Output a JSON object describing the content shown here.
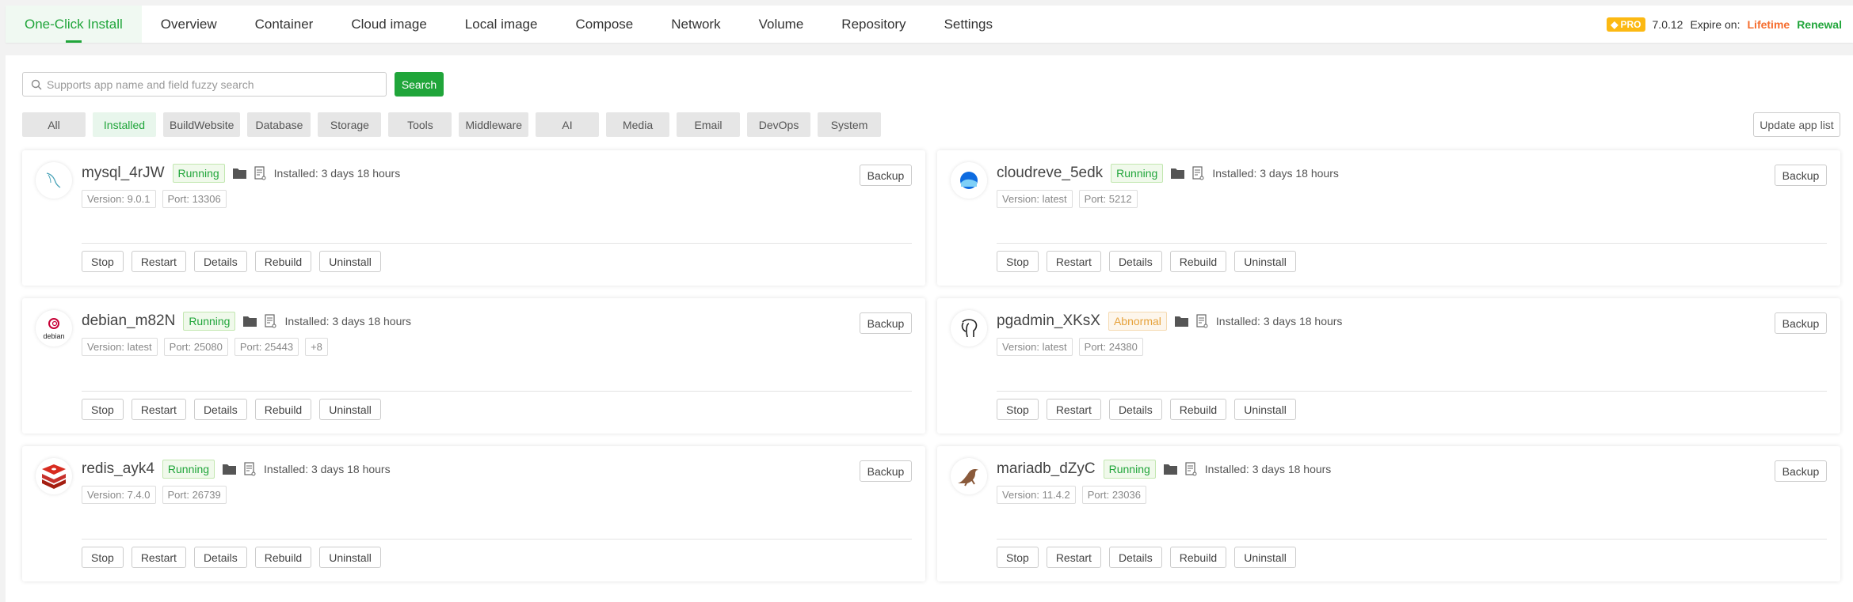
{
  "nav": {
    "tabs": [
      "One-Click Install",
      "Overview",
      "Container",
      "Cloud image",
      "Local image",
      "Compose",
      "Network",
      "Volume",
      "Repository",
      "Settings"
    ],
    "pro_label": "PRO",
    "version": "7.0.12",
    "expire_label": "Expire on:",
    "expire_value": "Lifetime",
    "renewal": "Renewal"
  },
  "search": {
    "placeholder": "Supports app name and field fuzzy search",
    "button": "Search"
  },
  "categories": [
    "All",
    "Installed",
    "BuildWebsite",
    "Database",
    "Storage",
    "Tools",
    "Middleware",
    "AI",
    "Media",
    "Email",
    "DevOps",
    "System"
  ],
  "active_category": "Installed",
  "update_button": "Update app list",
  "actions": [
    "Stop",
    "Restart",
    "Details",
    "Rebuild",
    "Uninstall"
  ],
  "backup_label": "Backup",
  "apps": [
    {
      "name": "mysql_4rJW",
      "status": "Running",
      "installed": "Installed: 3 days 18 hours",
      "tags": [
        "Version: 9.0.1",
        "Port: 13306"
      ],
      "icon": "mysql-icon"
    },
    {
      "name": "cloudreve_5edk",
      "status": "Running",
      "installed": "Installed: 3 days 18 hours",
      "tags": [
        "Version: latest",
        "Port: 5212"
      ],
      "icon": "cloudreve-icon"
    },
    {
      "name": "debian_m82N",
      "status": "Running",
      "installed": "Installed: 3 days 18 hours",
      "tags": [
        "Version: latest",
        "Port: 25080",
        "Port: 25443",
        "+8"
      ],
      "icon": "debian-icon",
      "icon_text": "debian"
    },
    {
      "name": "pgadmin_XKsX",
      "status": "Abnormal",
      "installed": "Installed: 3 days 18 hours",
      "tags": [
        "Version: latest",
        "Port: 24380"
      ],
      "icon": "postgres-elephant-icon"
    },
    {
      "name": "redis_ayk4",
      "status": "Running",
      "installed": "Installed: 3 days 18 hours",
      "tags": [
        "Version: 7.4.0",
        "Port: 26739"
      ],
      "icon": "redis-icon"
    },
    {
      "name": "mariadb_dZyC",
      "status": "Running",
      "installed": "Installed: 3 days 18 hours",
      "tags": [
        "Version: 11.4.2",
        "Port: 23036"
      ],
      "icon": "mariadb-seal-icon"
    }
  ]
}
